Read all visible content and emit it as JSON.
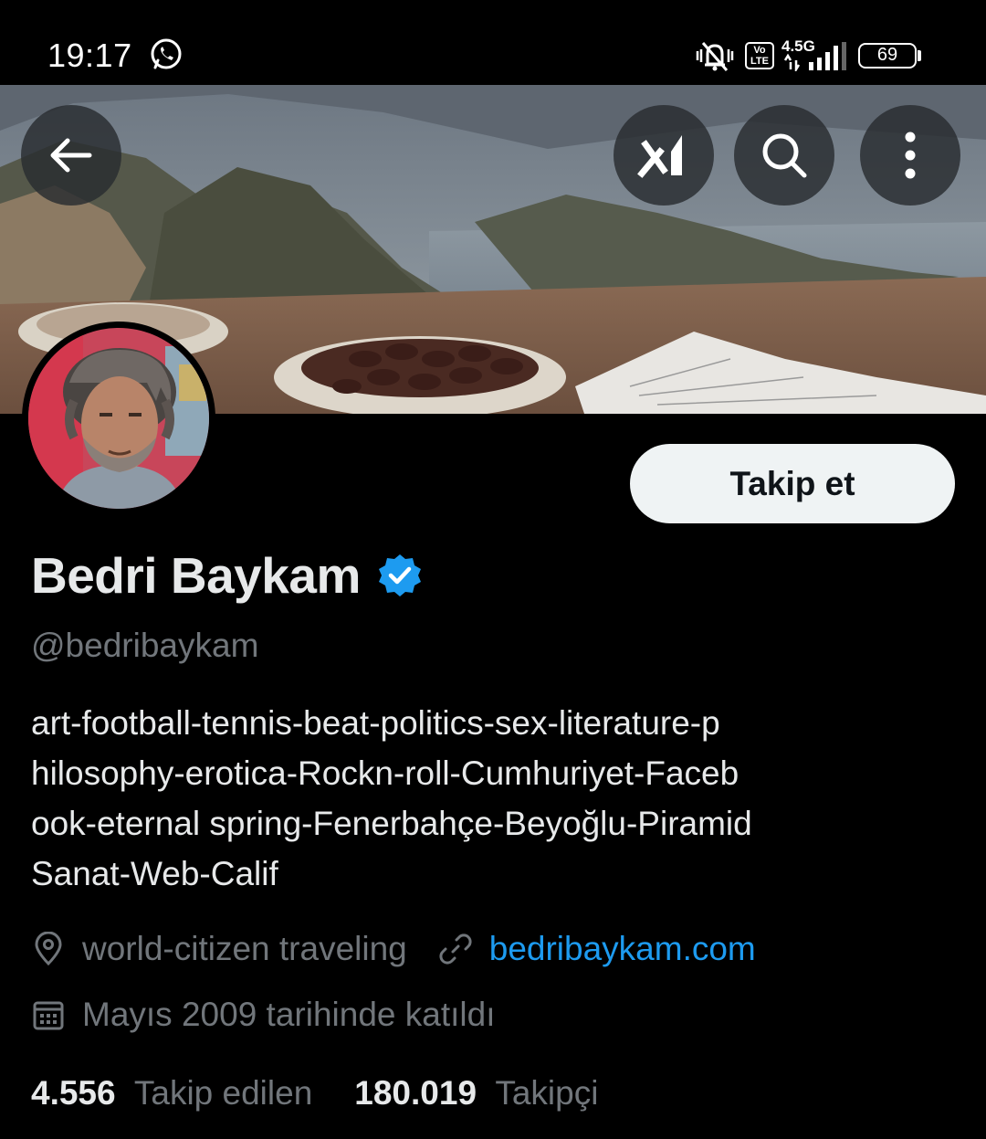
{
  "status_bar": {
    "time": "19:17",
    "network_type": "4.5G",
    "volte_label": "Vo\nLTE",
    "battery_level": "69",
    "icons": [
      "whatsapp-icon",
      "mute-icon",
      "volte-icon",
      "signal-icon",
      "battery-icon"
    ]
  },
  "header": {
    "back_icon": "arrow-left-icon",
    "grok_icon": "grok-icon",
    "search_icon": "search-icon",
    "more_icon": "more-vertical-icon"
  },
  "profile": {
    "follow_label": "Takip et",
    "display_name": "Bedri Baykam",
    "verified": true,
    "handle": "@bedribaykam",
    "bio": "art-football-tennis-beat-politics-sex-literature-p\nhilosophy-erotica-Rockn-roll-Cumhuriyet-Faceb\nook-eternal spring-Fenerbahçe-Beyoğlu-Piramid\nSanat-Web-Calif",
    "location": "world-citizen traveling",
    "website": "bedribaykam.com",
    "joined": "Mayıs 2009 tarihinde katıldı",
    "following_count": "4.556",
    "following_label": "Takip edilen",
    "followers_count": "180.019",
    "followers_label": "Takipçi"
  },
  "colors": {
    "background": "#000000",
    "accent_link": "#1d9bf0",
    "verified_badge": "#1d9bf0",
    "secondary_text": "#71767b",
    "follow_button_bg": "#eff3f4"
  }
}
